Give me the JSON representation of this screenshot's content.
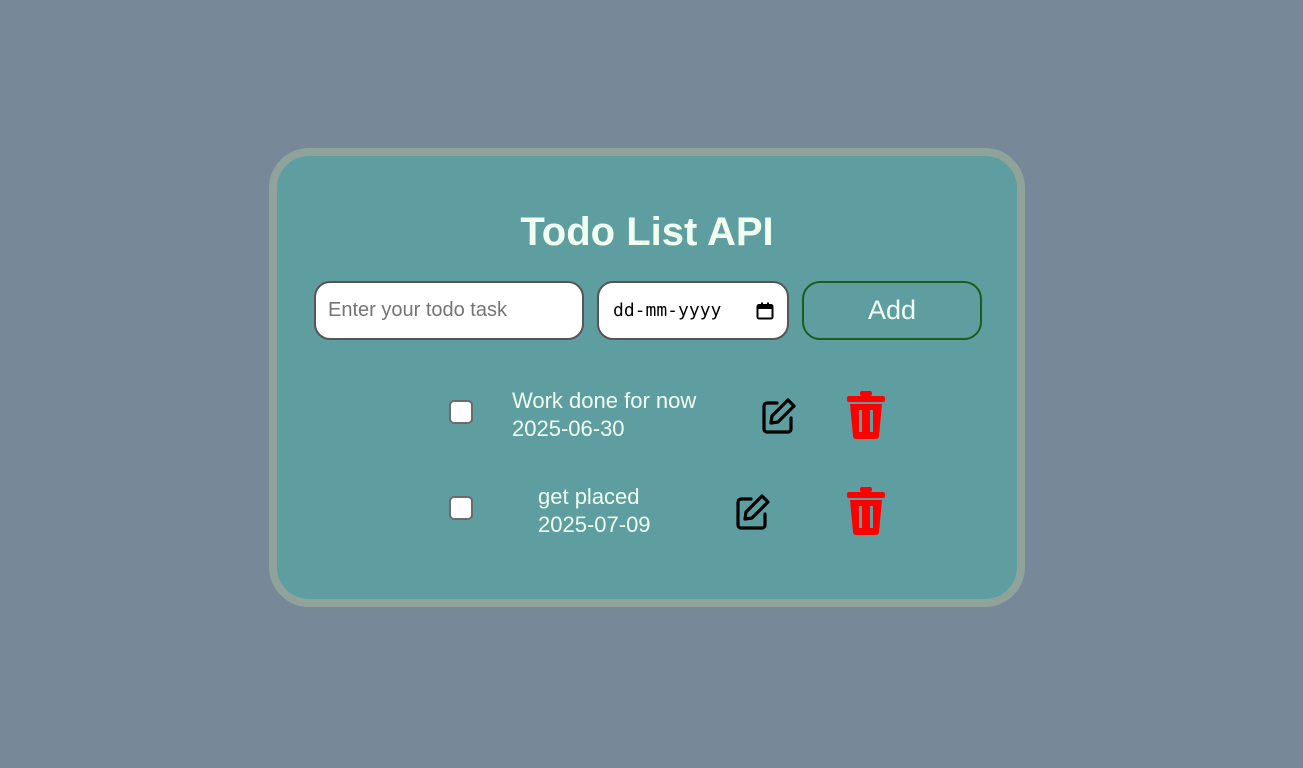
{
  "app": {
    "title": "Todo List API"
  },
  "form": {
    "task_placeholder": "Enter your todo task",
    "task_value": "",
    "date_display": "dd-mm-yyyy",
    "add_label": "Add"
  },
  "todos": [
    {
      "text": "Work done for now",
      "date": "2025-06-30",
      "done": false
    },
    {
      "text": "get placed",
      "date": "2025-07-09",
      "done": false
    }
  ],
  "icons": {
    "edit": "edit-icon",
    "delete": "trash-icon",
    "calendar": "calendar-icon"
  },
  "colors": {
    "page_background": "#778899",
    "card_background": "#5f9ea0",
    "card_border": "#8fa39a",
    "text": "#f0fff0",
    "add_border": "#1a5e1a",
    "delete": "#ff0000"
  }
}
